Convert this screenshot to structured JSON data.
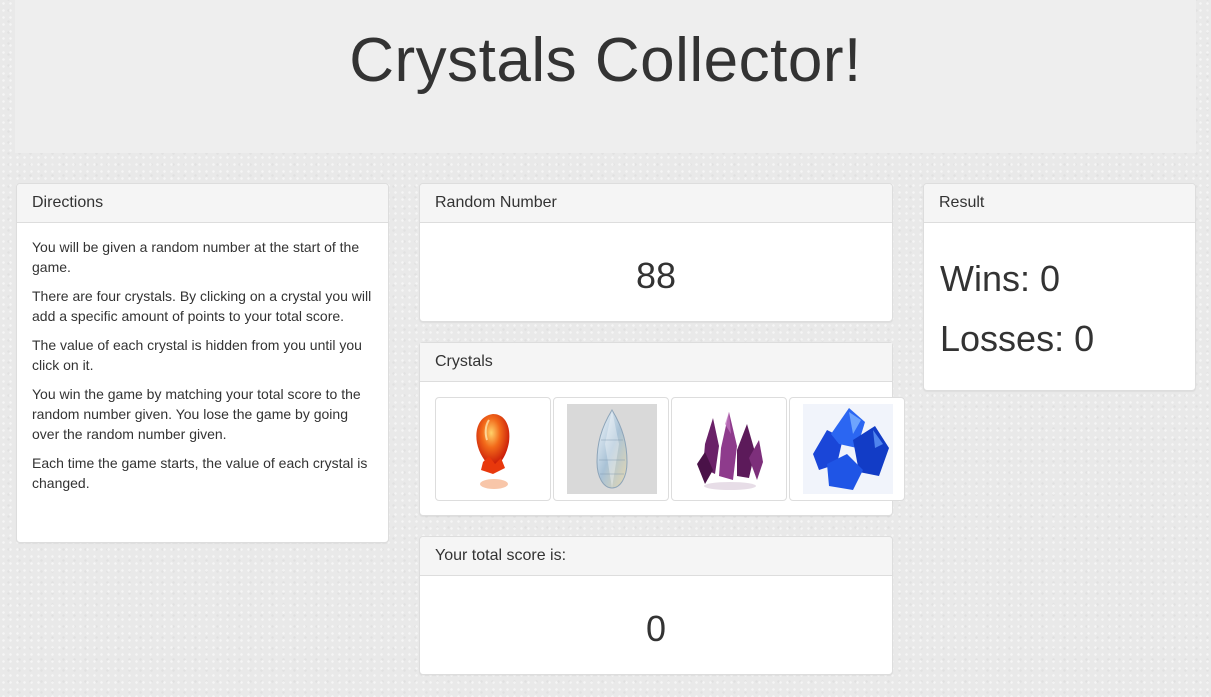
{
  "header": {
    "title": "Crystals Collector!"
  },
  "directions": {
    "heading": "Directions",
    "paragraphs": [
      "You will be given a random number at the start of the game.",
      "There are four crystals. By clicking on a crystal you will add a specific amount of points to your total score.",
      "The value of each crystal is hidden from you until you click on it.",
      "You win the game by matching your total score to the random number given. You lose the game by going over the random number given.",
      "Each time the game starts, the value of each crystal is changed."
    ]
  },
  "random_number": {
    "heading": "Random Number",
    "value": "88"
  },
  "crystals": {
    "heading": "Crystals",
    "items": [
      {
        "name": "red-orange crystal",
        "color": "#ee3a12"
      },
      {
        "name": "clear teardrop crystal",
        "color": "#b9c8d4"
      },
      {
        "name": "purple crystal cluster",
        "color": "#7a2a78"
      },
      {
        "name": "blue crystal cluster",
        "color": "#1f4fe0"
      }
    ]
  },
  "total_score": {
    "heading": "Your total score is:",
    "value": "0"
  },
  "result": {
    "heading": "Result",
    "wins_label": "Wins:",
    "wins": "0",
    "losses_label": "Losses:",
    "losses": "0"
  }
}
